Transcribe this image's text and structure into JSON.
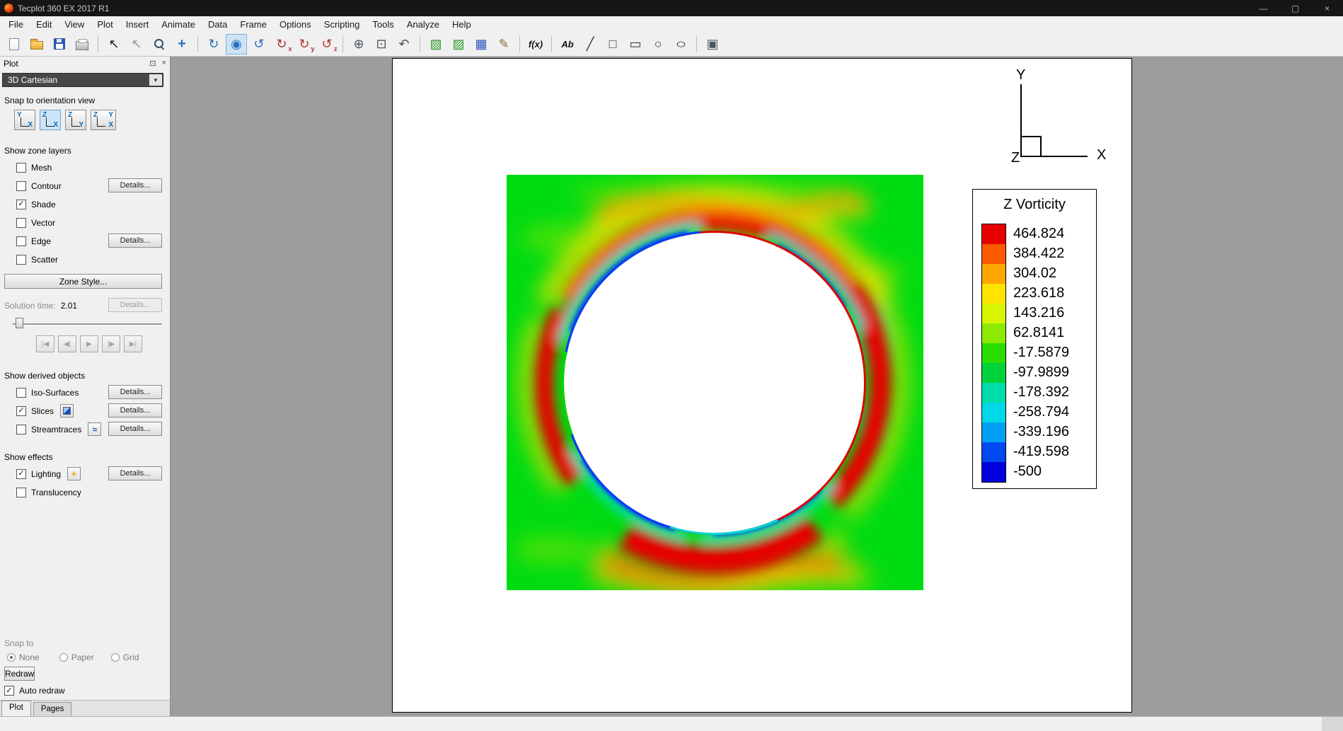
{
  "window": {
    "title": "Tecplot 360 EX 2017 R1",
    "controls": {
      "minimize": "—",
      "maximize": "▢",
      "close": "×"
    }
  },
  "menu": {
    "items": [
      "File",
      "Edit",
      "View",
      "Plot",
      "Insert",
      "Animate",
      "Data",
      "Frame",
      "Options",
      "Scripting",
      "Tools",
      "Analyze",
      "Help"
    ]
  },
  "toolbar": {
    "buttons": [
      {
        "name": "new-layout-button",
        "kind": "page"
      },
      {
        "name": "open-layout-button",
        "kind": "folder"
      },
      {
        "name": "save-layout-button",
        "kind": "floppy"
      },
      {
        "name": "print-button",
        "kind": "printer"
      },
      {
        "name": "sep"
      },
      {
        "name": "selector-tool",
        "glyph": "↖",
        "color": "#1a1a1a"
      },
      {
        "name": "adjustor-tool",
        "glyph": "↖",
        "color": "#9a9a9a"
      },
      {
        "name": "zoom-tool",
        "kind": "magnifier"
      },
      {
        "name": "translate-tool",
        "glyph": "+",
        "plus": true,
        "color": "#2a6fbb"
      },
      {
        "name": "sep"
      },
      {
        "name": "rotate-spherical-tool",
        "glyph": "↻",
        "color": "#2a6fbb"
      },
      {
        "name": "rotate-rollerball-tool",
        "glyph": "◉",
        "color": "#2a6fbb",
        "active": true
      },
      {
        "name": "rotate-twist-tool",
        "glyph": "↺",
        "color": "#2a6fbb"
      },
      {
        "name": "rotate-x-tool",
        "glyph": "↻",
        "sub": "x",
        "color": "#b03030"
      },
      {
        "name": "rotate-y-tool",
        "glyph": "↻",
        "sub": "y",
        "color": "#b03030"
      },
      {
        "name": "rotate-z-tool",
        "glyph": "↺",
        "sub": "z",
        "color": "#b03030"
      },
      {
        "name": "sep"
      },
      {
        "name": "center-view-button",
        "glyph": "⊕",
        "color": "#4a5560"
      },
      {
        "name": "fit-view-button",
        "glyph": "⊡",
        "color": "#4a5560"
      },
      {
        "name": "undo-view-button",
        "glyph": "↶",
        "color": "#4a5560"
      },
      {
        "name": "sep"
      },
      {
        "name": "contour-flood-toggle",
        "glyph": "▧",
        "color": "#2e9b2e"
      },
      {
        "name": "mesh-overlay-toggle",
        "glyph": "▨",
        "color": "#2e9b2e"
      },
      {
        "name": "data-spreadsheet-button",
        "glyph": "▦",
        "color": "#3355bb"
      },
      {
        "name": "quick-edit-button",
        "glyph": "✎",
        "color": "#8a6a2a"
      },
      {
        "name": "sep"
      },
      {
        "name": "equations-button",
        "glyph": "f(x)",
        "text": true
      },
      {
        "name": "sep"
      },
      {
        "name": "add-text-button",
        "glyph": "Ab",
        "text": true
      },
      {
        "name": "add-line-button",
        "glyph": "╱",
        "color": "#333333"
      },
      {
        "name": "add-square-button",
        "glyph": "□",
        "color": "#333333"
      },
      {
        "name": "add-rectangle-button",
        "glyph": "▭",
        "color": "#333333"
      },
      {
        "name": "add-circle-button",
        "glyph": "○",
        "color": "#333333"
      },
      {
        "name": "add-ellipse-button",
        "glyph": "○",
        "stretch": true,
        "color": "#333333"
      },
      {
        "name": "sep"
      },
      {
        "name": "frame-order-button",
        "glyph": "▣",
        "color": "#4a5560"
      }
    ]
  },
  "icons": {
    "check": "✓",
    "stream": "≈",
    "light": "☀",
    "float_panel": "⊡",
    "close_panel": "×",
    "combo_arrow": "▼"
  },
  "sidebar": {
    "panel_title": "Plot",
    "plot_type": "3D Cartesian",
    "snap_orientation_label": "Snap to orientation view",
    "orientation_buttons": [
      {
        "vert": "Y",
        "horiz": "X"
      },
      {
        "vert": "Z",
        "horiz": "X",
        "active": true
      },
      {
        "vert": "Z",
        "horiz": "Y"
      },
      {
        "vert": "Z",
        "horiz": "X",
        "diag": "Y",
        "wide": true
      }
    ],
    "zone_layers_label": "Show zone layers",
    "zone_layers": [
      {
        "label": "Mesh",
        "checked": false,
        "details": false
      },
      {
        "label": "Contour",
        "checked": false,
        "details": true
      },
      {
        "label": "Shade",
        "checked": true,
        "details": false
      },
      {
        "label": "Vector",
        "checked": false,
        "details": false
      },
      {
        "label": "Edge",
        "checked": false,
        "details": true
      },
      {
        "label": "Scatter",
        "checked": false,
        "details": false
      }
    ],
    "zone_style_button": "Zone Style...",
    "details_label": "Details...",
    "solution_time_label": "Solution time:",
    "solution_time_value": "2.01",
    "playback": [
      {
        "name": "first-frame-button",
        "glyph": "|◀"
      },
      {
        "name": "prev-frame-button",
        "glyph": "◀|"
      },
      {
        "name": "play-button",
        "glyph": "▶"
      },
      {
        "name": "next-frame-button",
        "glyph": "|▶"
      },
      {
        "name": "last-frame-button",
        "glyph": "▶|"
      }
    ],
    "derived_label": "Show derived objects",
    "derived": [
      {
        "label": "Iso-Surfaces",
        "checked": false,
        "icon": null,
        "details": true
      },
      {
        "label": "Slices",
        "checked": true,
        "icon": "slice",
        "details": true
      },
      {
        "label": "Streamtraces",
        "checked": false,
        "icon": "stream",
        "details": true
      }
    ],
    "effects_label": "Show effects",
    "effects": [
      {
        "label": "Lighting",
        "checked": true,
        "icon": "light",
        "details": true
      },
      {
        "label": "Translucency",
        "checked": false,
        "icon": null,
        "details": false
      }
    ],
    "snap_to_label": "Snap to",
    "snap_options": [
      {
        "label": "None",
        "selected": true
      },
      {
        "label": "Paper",
        "selected": false
      },
      {
        "label": "Grid",
        "selected": false
      }
    ],
    "redraw_button": "Redraw",
    "auto_redraw_label": "Auto redraw",
    "auto_redraw_checked": true,
    "tabs": [
      {
        "label": "Plot",
        "active": true
      },
      {
        "label": "Pages",
        "active": false
      }
    ]
  },
  "chart_data": {
    "type": "heatmap",
    "title": "Z Vorticity",
    "plot_kind": "2D contour slice of Z vorticity around a circular cylinder at solution time 2.01",
    "axes": {
      "x": "X",
      "y": "Y",
      "z": "Z"
    },
    "solution_time": "2.01",
    "field_colors": {
      "far_field_green": "#00dc12",
      "high_positive_red": "#e60000",
      "positive_orange": "#ff9500",
      "mid_yellow": "#ffe000",
      "negative_cyan": "#00dcd2",
      "strong_negative_blue": "#0040ff",
      "cylinder_fill": "#ffffff"
    },
    "legend": {
      "title": "Z Vorticity",
      "values": [
        "464.824",
        "384.422",
        "304.02",
        "223.618",
        "143.216",
        "62.8141",
        "-17.5879",
        "-97.9899",
        "-178.392",
        "-258.794",
        "-339.196",
        "-419.598",
        "-500"
      ],
      "colors": [
        "#e80000",
        "#fc5a00",
        "#ffa600",
        "#ffe400",
        "#d8f400",
        "#8cea00",
        "#2bdc00",
        "#00d23c",
        "#00dcaa",
        "#00d8e8",
        "#009ff2",
        "#0048f0",
        "#0000dc"
      ]
    },
    "value_range": [
      -500,
      464.824
    ]
  }
}
